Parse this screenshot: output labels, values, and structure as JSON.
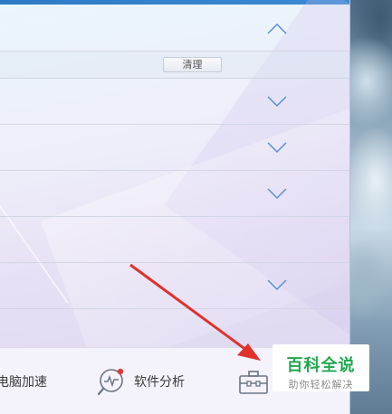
{
  "panel": {
    "clean_button": "清理",
    "rows": [
      {
        "expanded": true
      },
      {
        "expanded": false
      },
      {
        "expanded": false
      },
      {
        "expanded": false
      },
      {
        "expanded": false
      },
      {
        "expanded": false
      }
    ]
  },
  "bottombar": {
    "accelerate_label": "电脑加速",
    "analyze_label": "软件分析",
    "analyze_icon": "software-analysis-icon",
    "toolbox_icon": "toolbox-icon"
  },
  "watermark": {
    "title": "百科全说",
    "subtitle": "助你轻松解决"
  },
  "colors": {
    "accent_blue": "#2d79c6",
    "chevron": "#5a8fd0",
    "arrow_red": "#e0312b",
    "watermark_green": "#1fa84f"
  }
}
